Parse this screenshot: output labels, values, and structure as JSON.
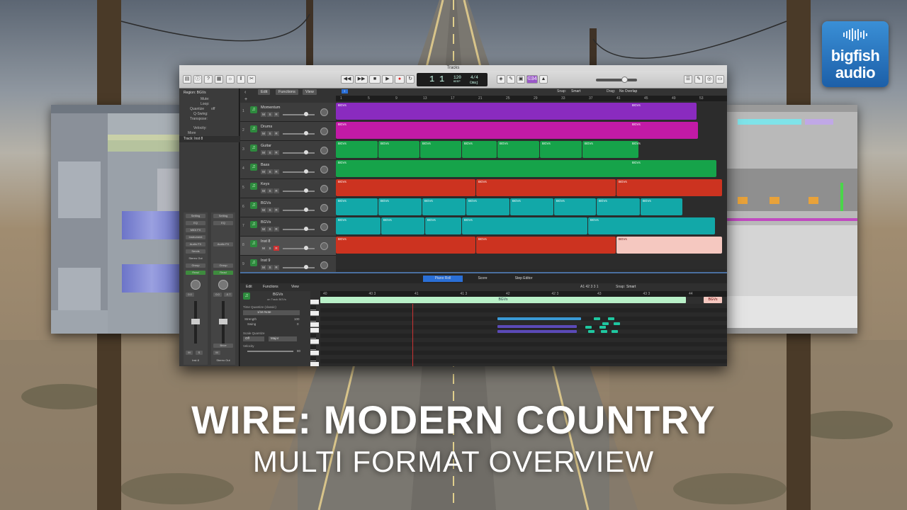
{
  "promo": {
    "title": "WIRE: MODERN COUNTRY",
    "subtitle": "MULTI FORMAT OVERVIEW"
  },
  "logo": {
    "line1": "bigfish",
    "line2": "audio"
  },
  "colors": {
    "purple": "#8a2bbf",
    "magenta": "#c21aa6",
    "green": "#16a34a",
    "red": "#cc3320",
    "teal": "#12a8a8",
    "accent": "#4a6fa0"
  },
  "logic": {
    "window_title": "Tracks",
    "lcd": {
      "bar": "1",
      "beat": "1",
      "tempo": "120",
      "keep": "KEEP",
      "sig": "4/4",
      "key": "Cmaj"
    },
    "snap_label": "Snap:",
    "snap_value": "Smart",
    "drag_label": "Drag:",
    "drag_value": "No Overlap",
    "count": "©34",
    "menus": {
      "edit": "Edit",
      "functions": "Functions",
      "view": "View"
    },
    "inspector": {
      "region": "Region: BGVs",
      "mute": "Mute:",
      "loop": "Loop:",
      "quantize": "Quantize",
      "quantize_val": "off",
      "qswing": "Q-Swing:",
      "transpose": "Transpose:",
      "velocity": "Velocity:",
      "more": "More",
      "track": "Track: Inst 8",
      "setting": "Setting",
      "eq": "EQ",
      "midi_fx": "MIDI FX",
      "instrument": "Instrument",
      "audio_fx": "Audio FX",
      "sends": "Sends",
      "stereo_out": "Stereo Out",
      "group": "Group",
      "read": "Read",
      "val1": "0.0",
      "val2": "0.0",
      "val3": "-0.7",
      "bnce": "Bnce",
      "strip1_name": "Inst 8",
      "strip2_name": "Stereo Out",
      "m": "M",
      "s": "S"
    },
    "ruler": [
      "1",
      "5",
      "9",
      "13",
      "17",
      "21",
      "25",
      "29",
      "33",
      "37",
      "41",
      "45",
      "49",
      "53"
    ],
    "tracks": [
      {
        "num": "1",
        "name": "Momentum",
        "color": "purple"
      },
      {
        "num": "2",
        "name": "Drums",
        "color": "magenta"
      },
      {
        "num": "3",
        "name": "Guitar",
        "color": "green"
      },
      {
        "num": "4",
        "name": "Bass",
        "color": "green"
      },
      {
        "num": "5",
        "name": "Keys",
        "color": "red"
      },
      {
        "num": "6",
        "name": "BGVs",
        "color": "teal"
      },
      {
        "num": "7",
        "name": "BGVs",
        "color": "teal"
      },
      {
        "num": "8",
        "name": "Inst 8",
        "color": "red"
      },
      {
        "num": "9",
        "name": "Inst 9",
        "color": "red"
      }
    ],
    "region_label": "BGVs",
    "msr": {
      "m": "M",
      "s": "S",
      "r": "R"
    },
    "editor": {
      "tabs": [
        "Piano Roll",
        "Score",
        "Step Editor"
      ],
      "region_name": "BGVs",
      "region_sub": "on Track BGVs",
      "time_quantize": "Time Quantize (classic)",
      "note_value": "1/16 Note",
      "strength": "Strength",
      "strength_val": "100",
      "swing": "Swing",
      "swing_val": "0",
      "scale_quantize": "Scale Quantize",
      "scale_off": "Off",
      "scale_major": "Major",
      "velocity": "Velocity",
      "velocity_val": "80",
      "position": "A1  42 3 3 1",
      "snap_label": "Snap:",
      "snap_value": "Smart",
      "ruler": [
        "40",
        "40 3",
        "41",
        "41 3",
        "42",
        "42 3",
        "43",
        "43 3",
        "44"
      ],
      "region_bar": "BGVs",
      "region_end": "BGVs"
    }
  }
}
